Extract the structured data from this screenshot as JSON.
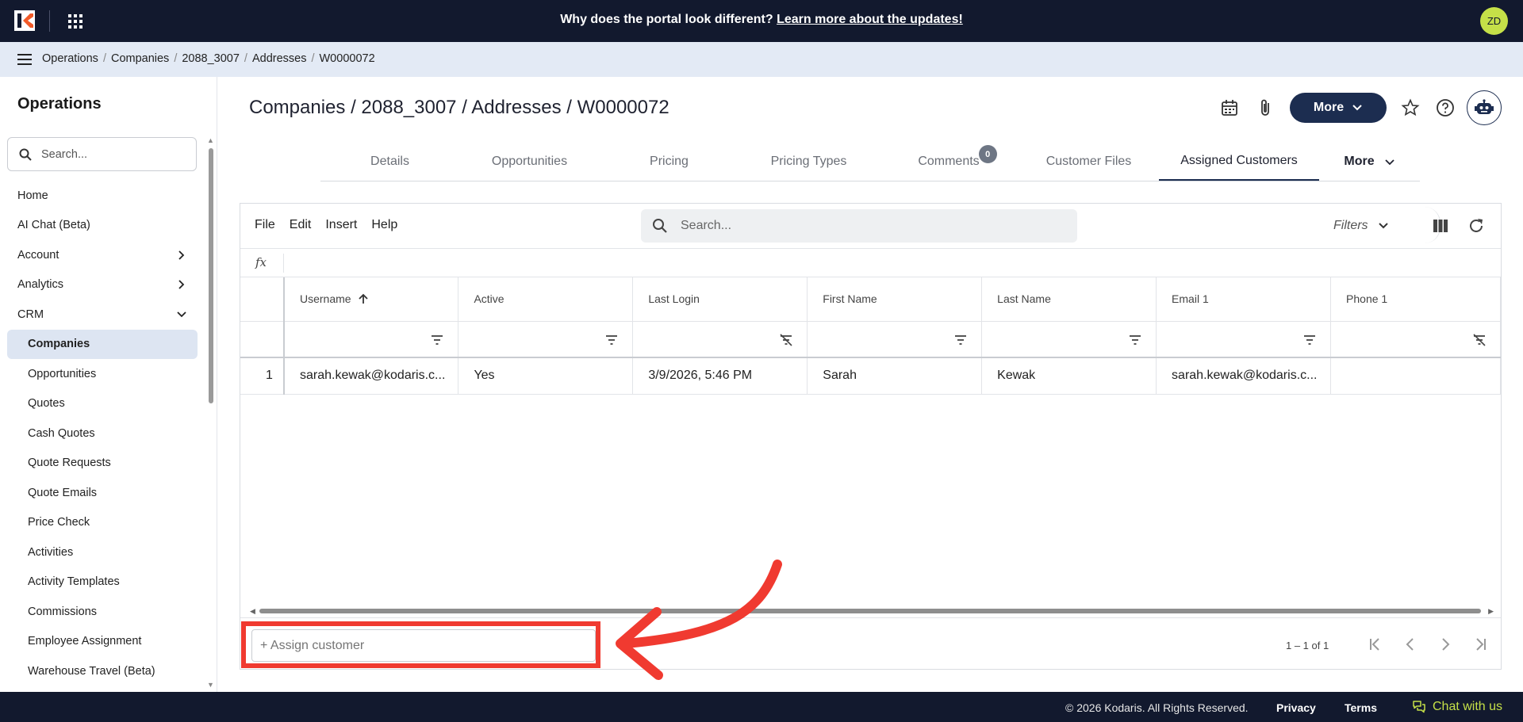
{
  "topbar": {
    "banner_text": "Why does the portal look different? ",
    "banner_link": "Learn more about the updates!",
    "avatar_initials": "ZD"
  },
  "breadcrumb": [
    "Operations",
    "Companies",
    "2088_3007",
    "Addresses",
    "W0000072"
  ],
  "sidebar": {
    "title": "Operations",
    "search_placeholder": "Search...",
    "items": [
      {
        "label": "Home"
      },
      {
        "label": "AI Chat (Beta)"
      },
      {
        "label": "Account"
      },
      {
        "label": "Analytics"
      },
      {
        "label": "CRM"
      },
      {
        "label": "Companies"
      },
      {
        "label": "Opportunities"
      },
      {
        "label": "Quotes"
      },
      {
        "label": "Cash Quotes"
      },
      {
        "label": "Quote Requests"
      },
      {
        "label": "Quote Emails"
      },
      {
        "label": "Price Check"
      },
      {
        "label": "Activities"
      },
      {
        "label": "Activity Templates"
      },
      {
        "label": "Commissions"
      },
      {
        "label": "Employee Assignment"
      },
      {
        "label": "Warehouse Travel (Beta)"
      }
    ]
  },
  "header": {
    "title": "Companies / 2088_3007 / Addresses / W0000072",
    "more_label": "More"
  },
  "tabs": [
    {
      "label": "Details"
    },
    {
      "label": "Opportunities"
    },
    {
      "label": "Pricing"
    },
    {
      "label": "Pricing Types"
    },
    {
      "label": "Comments",
      "badge": "0"
    },
    {
      "label": "Customer Files"
    },
    {
      "label": "Assigned Customers"
    },
    {
      "label": "More"
    }
  ],
  "grid": {
    "menu": [
      "File",
      "Edit",
      "Insert",
      "Help"
    ],
    "search_placeholder": "Search...",
    "filters_label": "Filters",
    "fx_label": "fx",
    "columns": [
      "Username",
      "Active",
      "Last Login",
      "First Name",
      "Last Name",
      "Email 1",
      "Phone 1"
    ],
    "rows": [
      {
        "num": "1",
        "cells": [
          "sarah.kewak@kodaris.c...",
          "Yes",
          "3/9/2026, 5:46 PM",
          "Sarah",
          "Kewak",
          "sarah.kewak@kodaris.c...",
          ""
        ]
      }
    ],
    "assign_placeholder": "+ Assign customer",
    "pager_text": "1 – 1 of 1"
  },
  "footer": {
    "copyright": "© 2026 Kodaris. All Rights Reserved.",
    "privacy": "Privacy",
    "terms": "Terms",
    "chat": "Chat with us"
  },
  "colors": {
    "navy": "#12192e",
    "accent": "#1c2d50",
    "lime": "#c5e048",
    "highlight_red": "#f03a30"
  }
}
